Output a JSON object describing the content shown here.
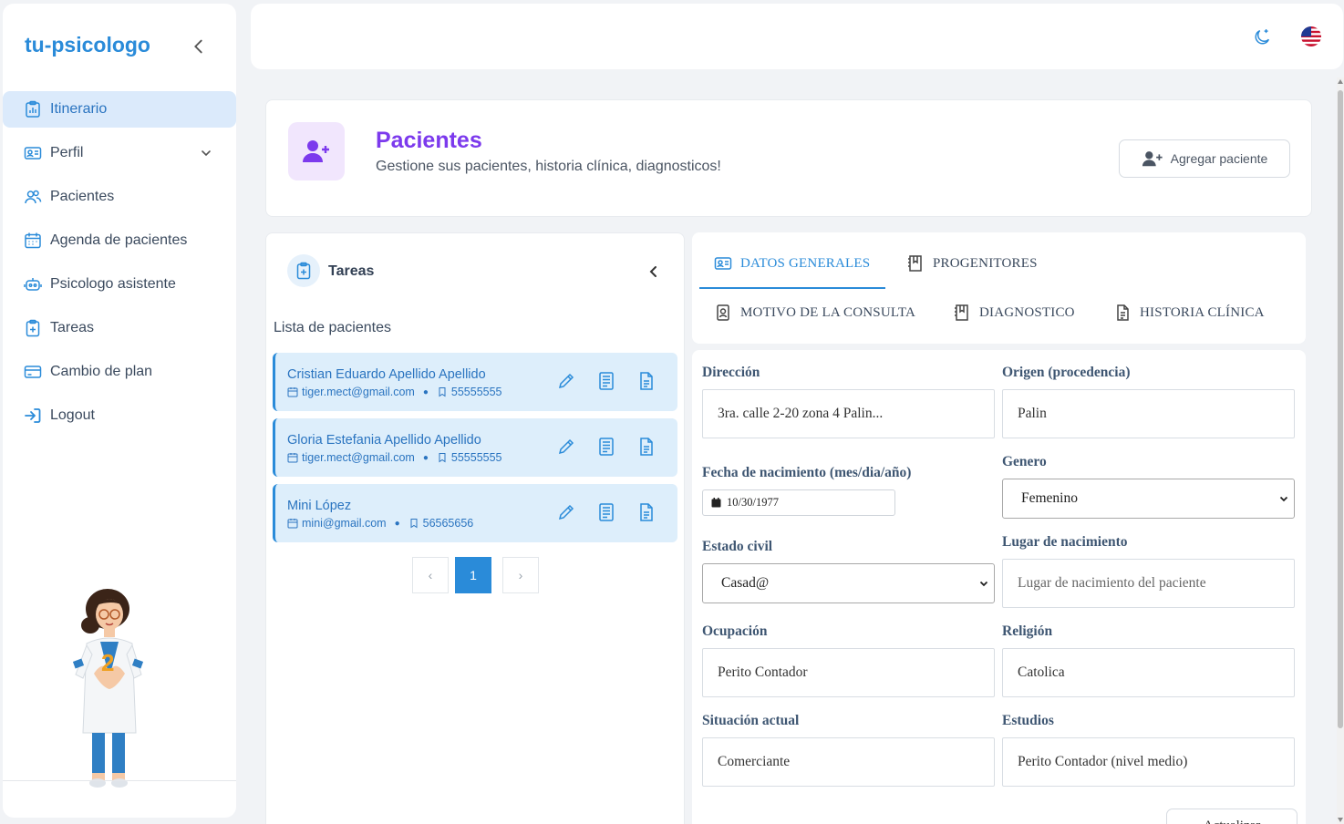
{
  "brand": "tu-psicologo",
  "sidebar": {
    "items": [
      {
        "label": "Itinerario",
        "icon": "itinerary-icon",
        "active": true
      },
      {
        "label": "Perfil",
        "icon": "profile-card-icon",
        "has_submenu": true
      },
      {
        "label": "Pacientes",
        "icon": "users-icon"
      },
      {
        "label": "Agenda de pacientes",
        "icon": "calendar-icon"
      },
      {
        "label": "Psicologo asistente",
        "icon": "robot-icon"
      },
      {
        "label": "Tareas",
        "icon": "clipboard-plus-icon"
      },
      {
        "label": "Cambio de plan",
        "icon": "credit-card-icon"
      },
      {
        "label": "Logout",
        "icon": "logout-icon"
      }
    ]
  },
  "topbar": {
    "theme_icon": "moon-icon",
    "language_icon": "us-flag-icon"
  },
  "header": {
    "title": "Pacientes",
    "subtitle": "Gestione sus pacientes, historia clínica, diagnosticos!",
    "add_button": "Agregar paciente"
  },
  "tasks": {
    "title": "Tareas",
    "list_title": "Lista de pacientes",
    "patients": [
      {
        "name": "Cristian Eduardo Apellido Apellido",
        "email": "tiger.mect@gmail.com",
        "phone": "55555555"
      },
      {
        "name": "Gloria Estefania Apellido Apellido",
        "email": "tiger.mect@gmail.com",
        "phone": "55555555"
      },
      {
        "name": "Mini López",
        "email": "mini@gmail.com",
        "phone": "56565656"
      }
    ],
    "pagination": {
      "prev": "‹",
      "current": "1",
      "next": "›"
    }
  },
  "tabs": [
    {
      "label": "DATOS GENERALES",
      "icon": "id-card-icon",
      "active": true
    },
    {
      "label": "PROGENITORES",
      "icon": "book-icon"
    },
    {
      "label": "MOTIVO DE LA CONSULTA",
      "icon": "badge-icon"
    },
    {
      "label": "DIAGNOSTICO",
      "icon": "book-icon"
    },
    {
      "label": "HISTORIA CLÍNICA",
      "icon": "document-icon"
    }
  ],
  "form": {
    "direccion": {
      "label": "Dirección",
      "value": "3ra. calle 2-20 zona 4 Palin..."
    },
    "origen": {
      "label": "Origen (procedencia)",
      "value": "Palin"
    },
    "fecha": {
      "label": "Fecha de nacimiento (mes/dia/año)",
      "value": "10/30/1977"
    },
    "genero": {
      "label": "Genero",
      "value": "Femenino"
    },
    "estado_civil": {
      "label": "Estado civil",
      "value": "Casad@"
    },
    "lugar_nacimiento": {
      "label": "Lugar de nacimiento",
      "placeholder": "Lugar de nacimiento del paciente"
    },
    "ocupacion": {
      "label": "Ocupación",
      "value": "Perito Contador"
    },
    "religion": {
      "label": "Religión",
      "value": "Catolica"
    },
    "situacion": {
      "label": "Situación actual",
      "value": "Comerciante"
    },
    "estudios": {
      "label": "Estudios",
      "value": "Perito Contador (nivel medio)"
    },
    "update_button": "Actualizar"
  },
  "colors": {
    "primary": "#2a8bd9",
    "accent_purple": "#7c3aed",
    "active_bg": "#dbeafb"
  }
}
